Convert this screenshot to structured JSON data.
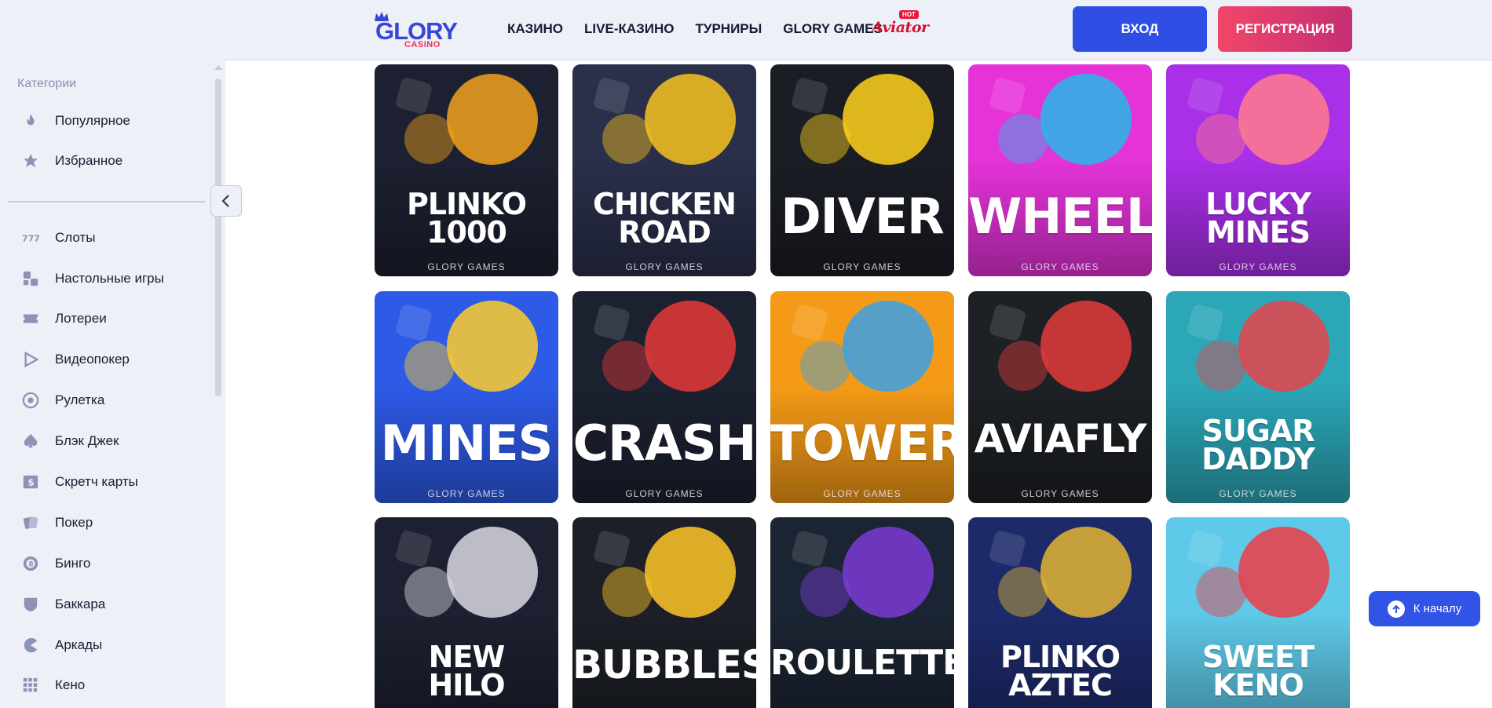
{
  "header": {
    "logo_main": "GLORY",
    "logo_sub": "CASINO",
    "nav": [
      "КАЗИНО",
      "LIVE-КАЗИНО",
      "ТУРНИРЫ",
      "GLORY GAMES"
    ],
    "aviator_label": "Aviator",
    "aviator_badge": "HOT",
    "login_label": "ВХОД",
    "register_label": "РЕГИСТРАЦИЯ"
  },
  "sidebar": {
    "heading": "Категории",
    "top_items": [
      {
        "label": "Популярное",
        "icon": "fire-icon"
      },
      {
        "label": "Избранное",
        "icon": "star-icon"
      }
    ],
    "items": [
      {
        "label": "Слоты",
        "icon": "slots-icon"
      },
      {
        "label": "Настольные игры",
        "icon": "table-games-icon"
      },
      {
        "label": "Лотереи",
        "icon": "ticket-icon"
      },
      {
        "label": "Видеопокер",
        "icon": "play-icon"
      },
      {
        "label": "Рулетка",
        "icon": "roulette-icon"
      },
      {
        "label": "Блэк Джек",
        "icon": "spade-icon"
      },
      {
        "label": "Скретч карты",
        "icon": "scratch-card-icon"
      },
      {
        "label": "Покер",
        "icon": "cards-icon"
      },
      {
        "label": "Бинго",
        "icon": "bingo-icon"
      },
      {
        "label": "Баккара",
        "icon": "baccarat-icon"
      },
      {
        "label": "Аркады",
        "icon": "pacman-icon"
      },
      {
        "label": "Кено",
        "icon": "keno-grid-icon"
      }
    ]
  },
  "games": [
    {
      "title": "PLINKO\n1000",
      "provider": "GLORY GAMES",
      "bg": "#1c2030",
      "accent": "#f2a21b"
    },
    {
      "title": "CHICKEN\nROAD",
      "provider": "GLORY GAMES",
      "bg": "#2a2f4a",
      "accent": "#f7c21e"
    },
    {
      "title": "DIVER",
      "provider": "GLORY GAMES",
      "bg": "#1b1d25",
      "accent": "#ffd21a"
    },
    {
      "title": "WHEEL",
      "provider": "GLORY GAMES",
      "bg": "#e533d9",
      "accent": "#27b9e6"
    },
    {
      "title": "LUCKY\nMINES",
      "provider": "GLORY GAMES",
      "bg": "#a92fe8",
      "accent": "#ff7b8c"
    },
    {
      "title": "MINES",
      "provider": "GLORY GAMES",
      "bg": "#2d5ae6",
      "accent": "#ffcd2b"
    },
    {
      "title": "CRASH",
      "provider": "GLORY GAMES",
      "bg": "#1c2130",
      "accent": "#e53838"
    },
    {
      "title": "TOWER",
      "provider": "GLORY GAMES",
      "bg": "#f49a17",
      "accent": "#3aa1e6"
    },
    {
      "title": "AVIAFLY",
      "provider": "GLORY GAMES",
      "bg": "#1d2024",
      "accent": "#e33b3b"
    },
    {
      "title": "SUGAR\nDADDY",
      "provider": "GLORY GAMES",
      "bg": "#2ba7b8",
      "accent": "#e8434a"
    },
    {
      "title": "NEW\nHILO",
      "provider": "",
      "bg": "#1c2030",
      "accent": "#d9d9e3"
    },
    {
      "title": "BUBBLES",
      "provider": "",
      "bg": "#1c1f27",
      "accent": "#ffc729"
    },
    {
      "title": "ROULETTE",
      "provider": "",
      "bg": "#1b2432",
      "accent": "#7b3bd6"
    },
    {
      "title": "PLINKO\nAZTEC",
      "provider": "",
      "bg": "#1d2a6a",
      "accent": "#e3b531"
    },
    {
      "title": "SWEET\nKENO",
      "provider": "",
      "bg": "#5ec9e8",
      "accent": "#ee3c47"
    }
  ],
  "to_top_label": "К началу"
}
